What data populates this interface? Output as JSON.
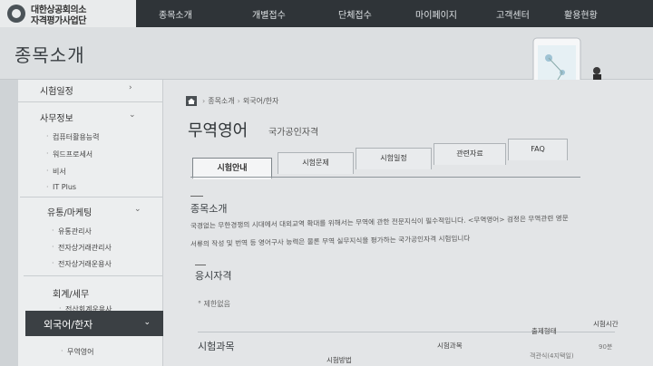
{
  "header": {
    "logo_line1": "대한상공회의소",
    "logo_line2": "자격평가사업단",
    "nav": [
      "종목소개",
      "개별접수",
      "단체접수",
      "마이페이지",
      "고객센터",
      "활용현황"
    ]
  },
  "band": {
    "title": "종목소개"
  },
  "sidebar": {
    "items": [
      {
        "label": "시험일정",
        "chevron": "›"
      },
      {
        "label": "사무정보",
        "chevron": "⌄",
        "subs": [
          "컴퓨터활용능력",
          "워드프로세서",
          "비서",
          "IT Plus"
        ]
      },
      {
        "label": "유통/마케팅",
        "chevron": "⌄",
        "subs": [
          "유통관리사",
          "전자상거래관리사",
          "전자상거래운용사"
        ]
      },
      {
        "label": "회계/세무",
        "chevron": "",
        "subs": [
          "전산회계운용사"
        ]
      },
      {
        "label": "외국어/한자",
        "chevron": "⌄",
        "subs": [
          "무역영어"
        ]
      }
    ]
  },
  "breadcrumb": {
    "level1": "종목소개",
    "level2": "외국어/한자"
  },
  "page": {
    "title": "무역영어",
    "subtitle": "국가공인자격"
  },
  "tabs": [
    "시험안내",
    "시험문제",
    "시험일정",
    "관련자료",
    "FAQ"
  ],
  "sections": {
    "intro_head": "종목소개",
    "intro_line1": "국경없는 무한경쟁의 시대에서 대외교역 확대를 위해서는 무역에 관한 전문지식이 필수적입니다. <무역영어> 검정은 무역관련 영문",
    "intro_line2": "서류의 작성 및 번역 등 영어구사 능력은 물론 무역 실무지식을 평가하는 국가공인자격 시험입니다",
    "qual_head": "응시자격",
    "qual_item": "제한없음",
    "subject_head": "시험과목",
    "table_headers": [
      "시험과목",
      "출제형태",
      "시험시간"
    ],
    "table_sub": "시험방법",
    "table_cells": [
      "객관식(4지택일)",
      "90분"
    ]
  },
  "colors": {
    "nav_bg": "#2f3438",
    "active_menu": "#3b4044"
  }
}
